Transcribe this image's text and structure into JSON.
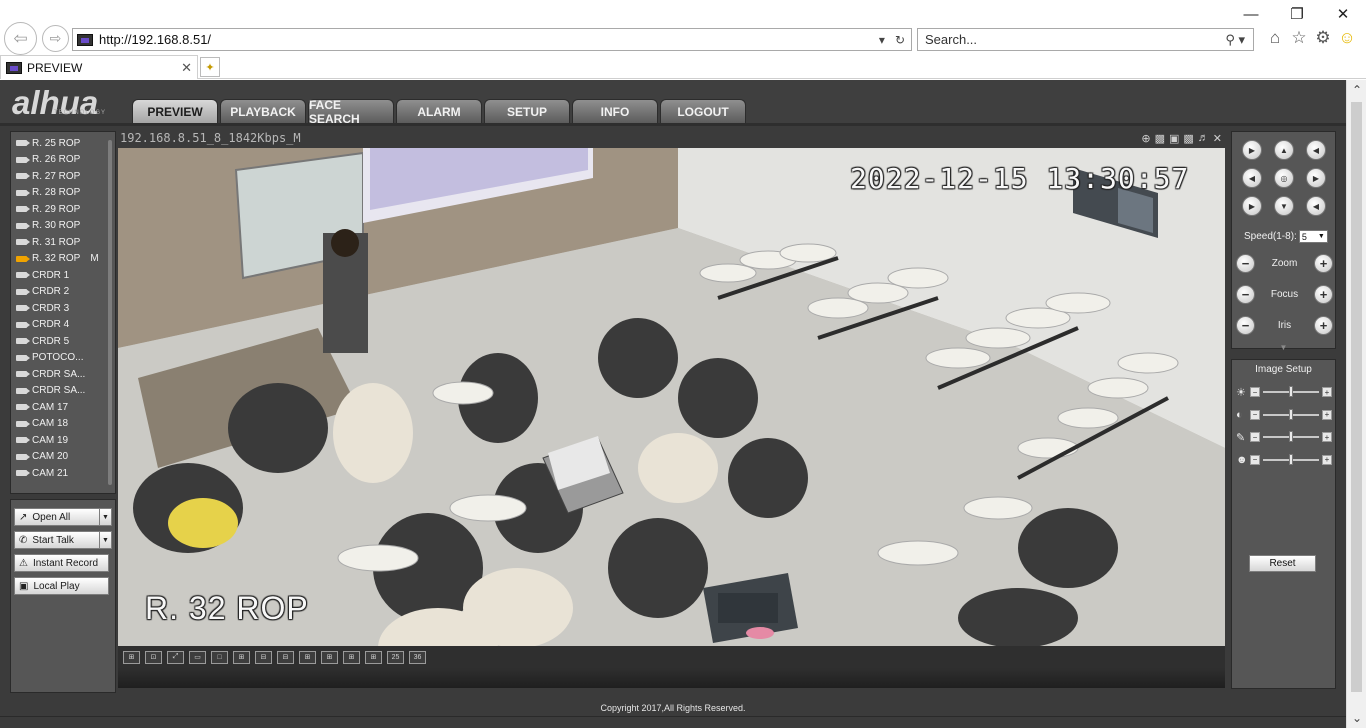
{
  "browser": {
    "url": "http://192.168.8.51/",
    "search_placeholder": "Search...",
    "tab_title": "PREVIEW",
    "window_controls": [
      "minimize-icon",
      "restore-icon",
      "close-icon"
    ],
    "toolbar_icons": [
      "home-icon",
      "star-icon",
      "gear-icon",
      "smiley-icon"
    ]
  },
  "app": {
    "logo": "alhua",
    "logo_sub": "TECHNOLOGY",
    "menu": [
      {
        "label": "PREVIEW",
        "active": true
      },
      {
        "label": "PLAYBACK",
        "active": false
      },
      {
        "label": "FACE SEARCH",
        "active": false
      },
      {
        "label": "ALARM",
        "active": false
      },
      {
        "label": "SETUP",
        "active": false
      },
      {
        "label": "INFO",
        "active": false
      },
      {
        "label": "LOGOUT",
        "active": false
      }
    ],
    "footer": "Copyright 2017,All Rights Reserved."
  },
  "cameras": [
    {
      "label": "R. 25 ROP"
    },
    {
      "label": "R. 26 ROP"
    },
    {
      "label": "R. 27 ROP"
    },
    {
      "label": "R. 28 ROP"
    },
    {
      "label": "R. 29 ROP"
    },
    {
      "label": "R. 30 ROP"
    },
    {
      "label": "R. 31 ROP"
    },
    {
      "label": "R. 32 ROP",
      "active": true,
      "mark": "M"
    },
    {
      "label": "CRDR 1"
    },
    {
      "label": "CRDR 2"
    },
    {
      "label": "CRDR 3"
    },
    {
      "label": "CRDR 4"
    },
    {
      "label": "CRDR 5"
    },
    {
      "label": "POTOCO..."
    },
    {
      "label": "CRDR SA..."
    },
    {
      "label": "CRDR SA..."
    },
    {
      "label": "CAM 17"
    },
    {
      "label": "CAM 18"
    },
    {
      "label": "CAM 19"
    },
    {
      "label": "CAM 20"
    },
    {
      "label": "CAM 21"
    }
  ],
  "controls": {
    "open_all": "Open All",
    "start_talk": "Start Talk",
    "instant_record": "Instant Record",
    "local_play": "Local Play"
  },
  "video": {
    "stream_info": "192.168.8.51_8_1842Kbps_M",
    "osd_time": "2022-12-15 13:30:57",
    "osd_name": "R. 32 ROP",
    "layout_buttons": [
      "⊞",
      "⊡",
      "⤢",
      "▭",
      "□",
      "⊞",
      "⊟",
      "⊟",
      "⊞",
      "⊞",
      "⊞",
      "⊞",
      "25",
      "36"
    ]
  },
  "ptz": {
    "speed_label": "Speed(1-8):",
    "speed_value": "5",
    "zoom_label": "Zoom",
    "focus_label": "Focus",
    "iris_label": "Iris"
  },
  "image_setup": {
    "title": "Image Setup",
    "reset": "Reset",
    "sliders": [
      {
        "icon": "brightness-icon",
        "value": 0.5
      },
      {
        "icon": "contrast-icon",
        "value": 0.5
      },
      {
        "icon": "saturation-icon",
        "value": 0.5
      },
      {
        "icon": "hue-icon",
        "value": 0.5
      }
    ]
  }
}
